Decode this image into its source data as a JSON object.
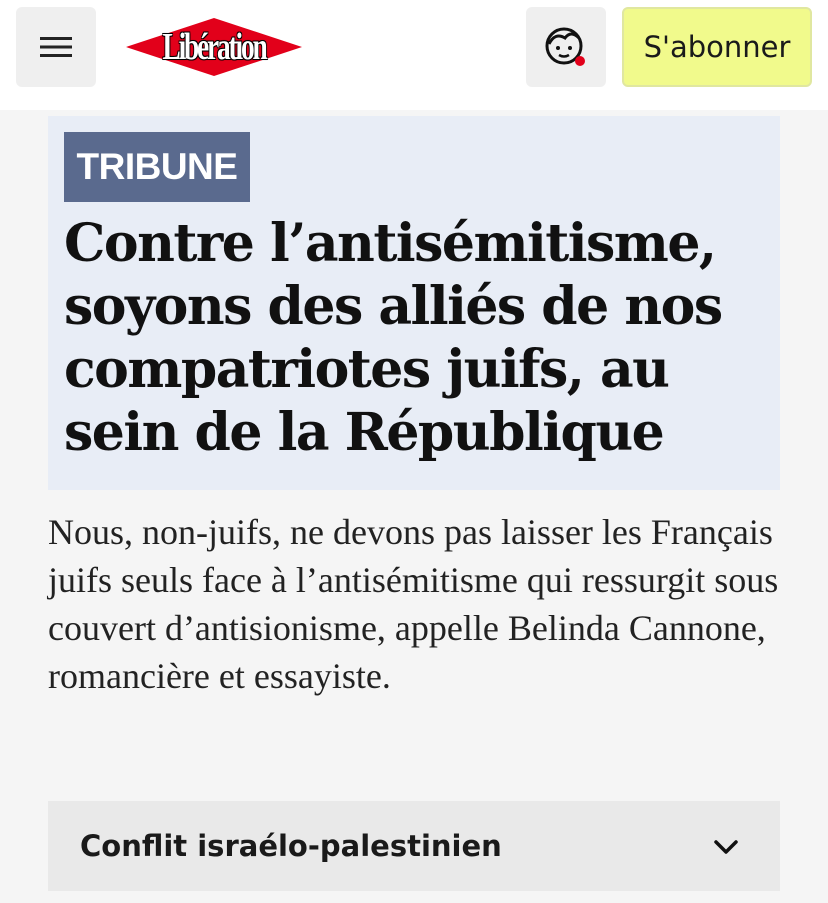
{
  "header": {
    "logo_text": "Libération",
    "subscribe_label": "S'abonner",
    "menu_icon": "hamburger-menu-icon",
    "account_icon": "user-avatar-icon"
  },
  "article": {
    "badge": "TRIBUNE",
    "title": "Contre l’antisémitisme, soyons des alliés de nos compatriotes juifs, au sein de la République",
    "lede": "Nous, non-juifs, ne devons pas laisser les Français juifs seuls face à l’antisémitisme qui ressurgit sous couvert d’antisionisme, appelle Belinda Cannone, romancière et essayiste."
  },
  "topic": {
    "label": "Conflit israélo-palestinien",
    "icon": "chevron-down-icon"
  },
  "colors": {
    "subscribe_bg": "#f1fa8c",
    "badge_bg": "#5a6a8e",
    "headline_bg": "#e8edf6",
    "logo_red": "#e2001a",
    "notification_dot": "#e2001a"
  }
}
